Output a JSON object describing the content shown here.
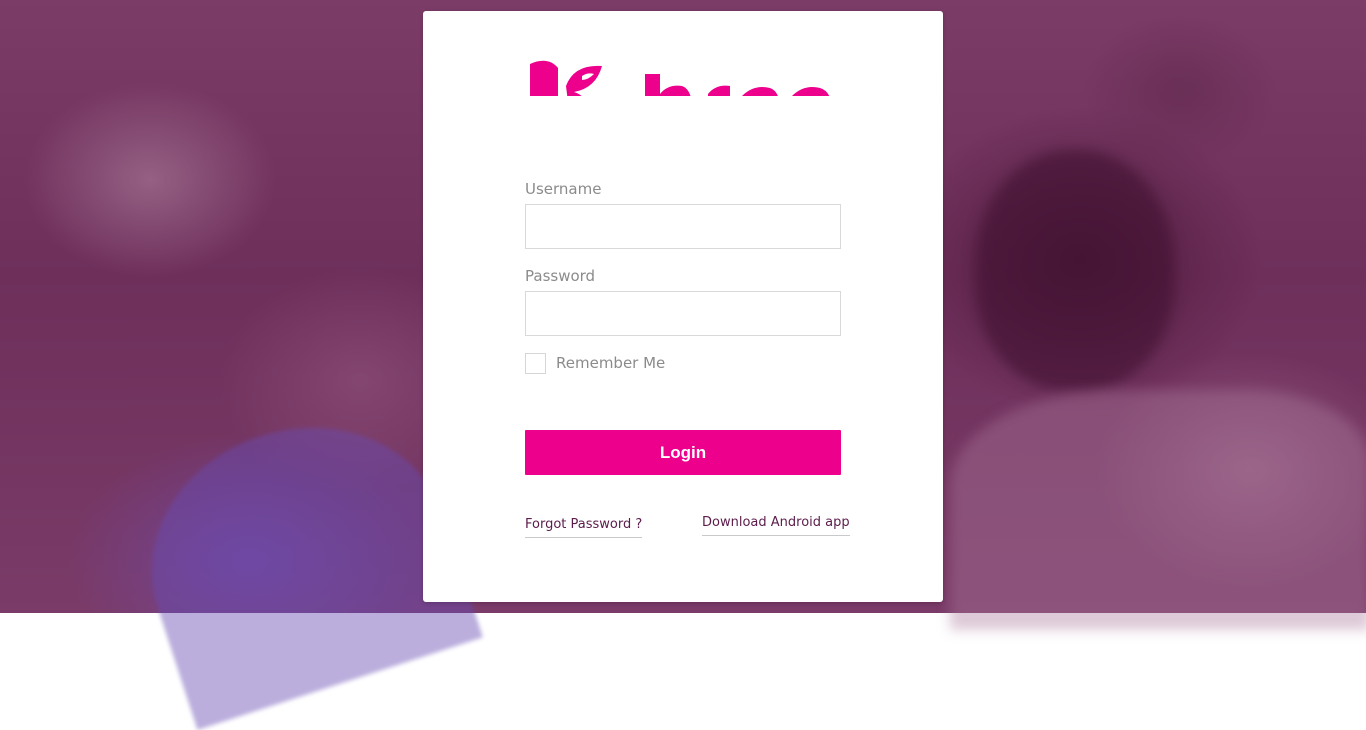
{
  "brand": {
    "name": "bran",
    "accent_color": "#ec008c",
    "link_color": "#5b1c4a"
  },
  "login_form": {
    "username": {
      "label": "Username",
      "value": "",
      "placeholder": ""
    },
    "password": {
      "label": "Password",
      "value": "",
      "placeholder": ""
    },
    "remember_me": {
      "label": "Remember Me",
      "checked": false
    },
    "submit_label": "Login"
  },
  "links": {
    "forgot_password": "Forgot Password ?",
    "download_android": "Download Android app"
  },
  "icons": {
    "logo": "brand-logo-icon"
  }
}
